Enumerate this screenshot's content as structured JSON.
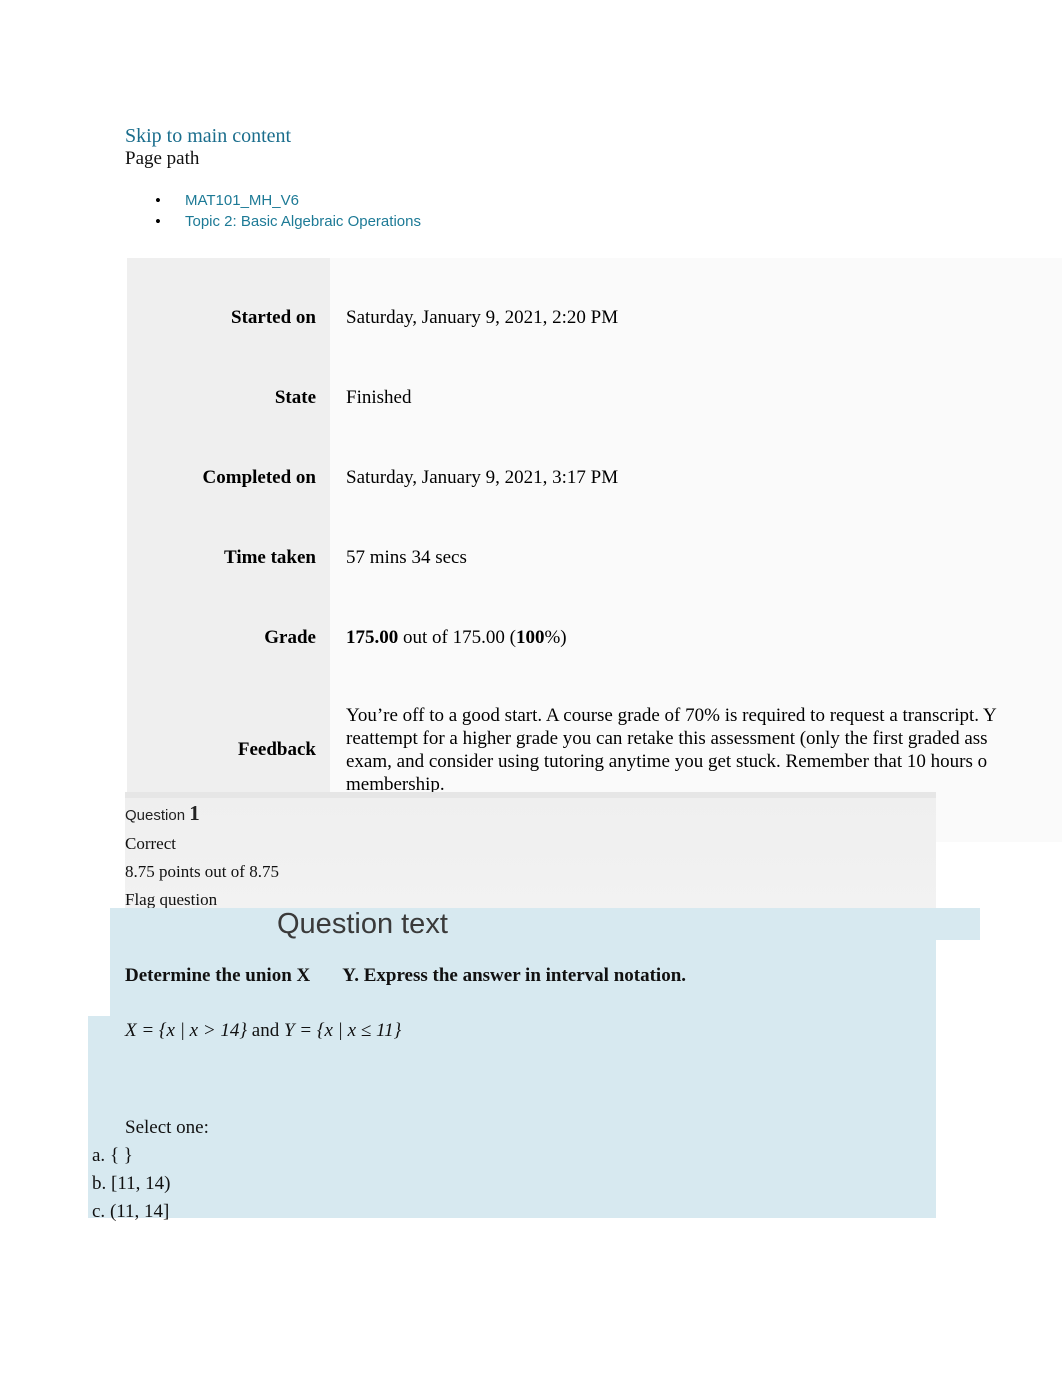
{
  "header": {
    "skip_link": "Skip to main content",
    "page_path_label": "Page path",
    "breadcrumbs": [
      {
        "label": "MAT101_MH_V6"
      },
      {
        "label": "Topic 2: Basic Algebraic Operations"
      }
    ]
  },
  "summary": {
    "rows": [
      {
        "label": "Started on",
        "value": "Saturday, January 9, 2021, 2:20 PM"
      },
      {
        "label": "State",
        "value": "Finished"
      },
      {
        "label": "Completed on",
        "value": "Saturday, January 9, 2021, 3:17 PM"
      },
      {
        "label": "Time taken",
        "value": "57 mins 34 secs"
      }
    ],
    "grade": {
      "label": "Grade",
      "score": "175.00",
      "middle": " out of 175.00 (",
      "percent": "100",
      "suffix": "%)"
    },
    "feedback": {
      "label": "Feedback",
      "line1": "You’re off to a good start. A course grade of 70% is required to request a transcript. Y",
      "line2": "reattempt for a higher grade you can retake this assessment (only the first graded ass",
      "line3": "exam, and consider using tutoring anytime you get stuck. Remember that 10 hours o",
      "line4": "membership."
    }
  },
  "question": {
    "number_label": "Question",
    "number": "1",
    "state": "Correct",
    "points": "8.75 points out of 8.75",
    "flag": "Flag question",
    "question_text_heading": "Question text",
    "prompt_before": "Determine the union X",
    "prompt_after": "Y. Express the answer in interval notation.",
    "sets_x": "X = {x | x > 14}",
    "sets_and": " and ",
    "sets_y": "Y = {x | x ≤ 11}",
    "select_one": "Select one:",
    "options": [
      {
        "letter": "a.",
        "text": "{ }"
      },
      {
        "letter": "b.",
        "text": "[11, 14)"
      },
      {
        "letter": "c.",
        "text": "(11, 14]"
      }
    ]
  },
  "colors": {
    "link": "#1d7a96",
    "panel_blue": "#d7e9f0",
    "label_gray": "#efefef",
    "value_gray": "#fafafa"
  }
}
